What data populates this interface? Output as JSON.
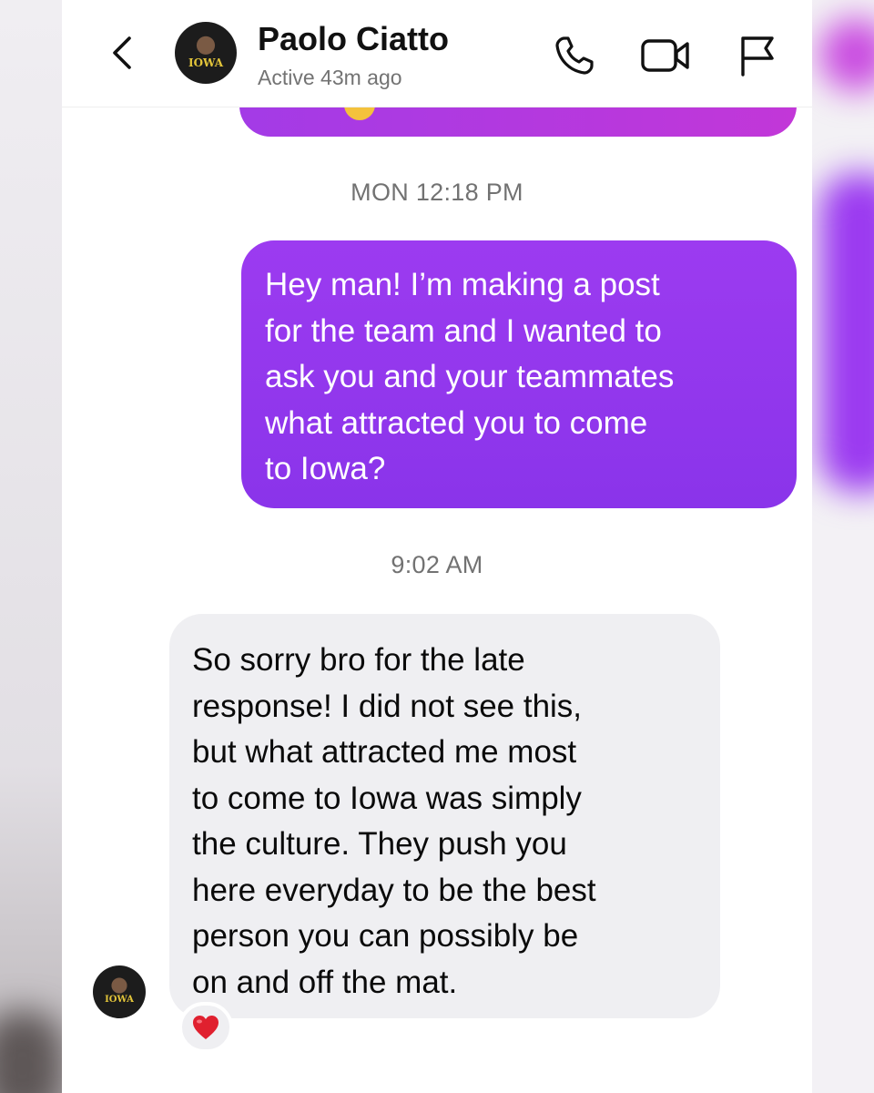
{
  "header": {
    "contact_name": "Paolo Ciatto",
    "status": "Active 43m ago",
    "avatar_text": "IOWA"
  },
  "icons": {
    "back": "chevron-left-icon",
    "call": "phone-icon",
    "video": "video-camera-icon",
    "report": "flag-icon",
    "reaction": "heart-icon"
  },
  "colors": {
    "sent_bubble": "#9c3bf0",
    "received_bubble": "#efeff2",
    "timestamp_text": "#727272",
    "heart": "#e0202f"
  },
  "messages": [
    {
      "timestamp": "MON 12:18 PM",
      "direction": "sent",
      "text": "Hey man! I’m making a post\nfor the team and I wanted to\nask you and your teammates\nwhat attracted you to come\nto Iowa?"
    },
    {
      "timestamp": "9:02 AM",
      "direction": "received",
      "text": "So sorry bro for the late\nresponse! I did not see this,\nbut what attracted me most\nto come to Iowa was simply\nthe culture. They push you\nhere everyday to be the best\nperson you can possibly be\non and off the mat.",
      "reaction": "❤️"
    }
  ]
}
